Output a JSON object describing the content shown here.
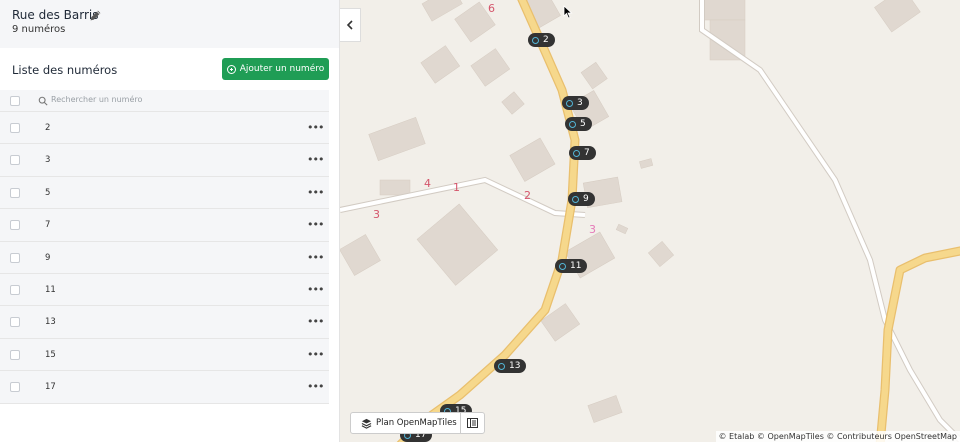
{
  "sidebar": {
    "street_name": "Rue des Barris",
    "numbers_count": "9 numéros",
    "list_title": "Liste des numéros",
    "add_button": "Ajouter un numéro",
    "search_placeholder": "Rechercher un numéro",
    "rows": [
      "2",
      "3",
      "5",
      "7",
      "9",
      "11",
      "13",
      "15",
      "17"
    ],
    "row_menu": "•••"
  },
  "map": {
    "markers": [
      "2",
      "3",
      "5",
      "7",
      "9",
      "11",
      "13",
      "15",
      "17"
    ],
    "labels": [
      "6",
      "4",
      "1",
      "2",
      "3",
      "3"
    ],
    "style_label": "Plan OpenMapTiles",
    "attribution": "© Etalab © OpenMapTiles © Contributeurs OpenStreetMap"
  },
  "colors": {
    "primary_green": "#1f9d55",
    "road_yellow": "#f6d88c",
    "marker_bg": "#333333",
    "marker_ring": "#53b5d6",
    "label_red": "#d4556b",
    "label_pink": "#e57ab8"
  }
}
